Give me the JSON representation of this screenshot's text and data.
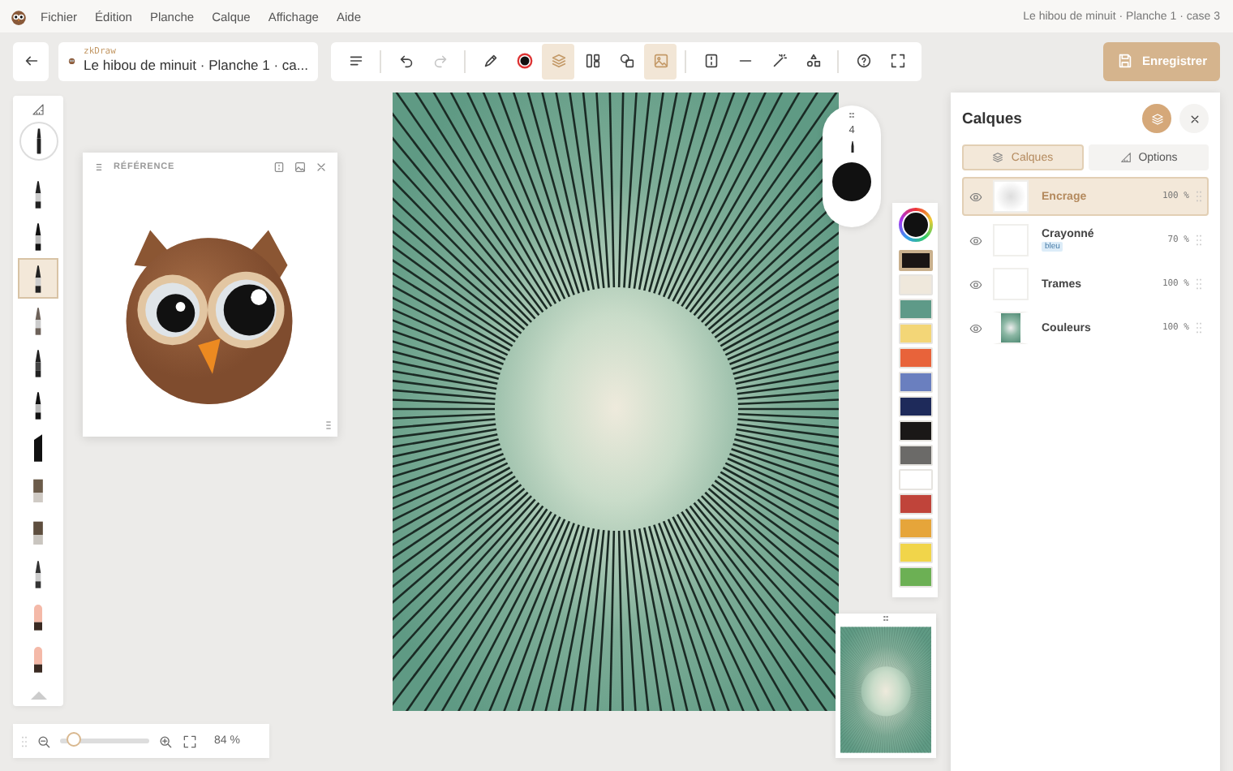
{
  "menu": [
    "Fichier",
    "Édition",
    "Planche",
    "Calque",
    "Affichage",
    "Aide"
  ],
  "document_title": "Le hibou de minuit · Planche 1 · case 3",
  "project": {
    "app": "zkDraw",
    "title": "Le hibou de minuit · Planche 1 · ca..."
  },
  "toolbar": {
    "groups": [
      [
        {
          "kind": "menu",
          "selected": false,
          "disabled": false
        }
      ],
      [
        {
          "kind": "undo",
          "selected": false,
          "disabled": false
        },
        {
          "kind": "redo",
          "selected": false,
          "disabled": true
        }
      ],
      [
        {
          "kind": "pen",
          "selected": false,
          "disabled": false
        },
        {
          "kind": "color",
          "selected": false,
          "disabled": false
        },
        {
          "kind": "layers",
          "selected": true,
          "disabled": false
        },
        {
          "kind": "panels",
          "selected": false,
          "disabled": false
        },
        {
          "kind": "shapes",
          "selected": false,
          "disabled": false
        },
        {
          "kind": "image",
          "selected": true,
          "disabled": false
        }
      ],
      [
        {
          "kind": "split",
          "selected": false,
          "disabled": false
        },
        {
          "kind": "line",
          "selected": false,
          "disabled": false
        },
        {
          "kind": "magic",
          "selected": false,
          "disabled": false
        },
        {
          "kind": "objects",
          "selected": false,
          "disabled": false
        }
      ],
      [
        {
          "kind": "help",
          "selected": false,
          "disabled": false
        },
        {
          "kind": "fullscreen",
          "selected": false,
          "disabled": false
        }
      ]
    ]
  },
  "save_button": "Enregistrer",
  "brushes": [
    {
      "kind": "pen",
      "selected": false
    },
    {
      "kind": "ink",
      "selected": false
    },
    {
      "kind": "pen",
      "selected": true
    },
    {
      "kind": "pencil",
      "selected": false
    },
    {
      "kind": "marker",
      "selected": false
    },
    {
      "kind": "ink",
      "selected": false
    },
    {
      "kind": "chisel",
      "selected": false
    },
    {
      "kind": "brush",
      "selected": false
    },
    {
      "kind": "flat",
      "selected": false
    },
    {
      "kind": "airbrush",
      "selected": false
    },
    {
      "kind": "eraser",
      "selected": false
    },
    {
      "kind": "soft-eraser",
      "selected": false
    }
  ],
  "reference": {
    "title": "RÉFÉRENCE"
  },
  "brush_size": {
    "value": "4"
  },
  "palette": [
    {
      "color": "#1a1514",
      "selected": true
    },
    {
      "color": "#efe8dc",
      "selected": false
    },
    {
      "color": "#5e9a88",
      "selected": false
    },
    {
      "color": "#f3d677",
      "selected": false
    },
    {
      "color": "#e8633a",
      "selected": false
    },
    {
      "color": "#6a7fbf",
      "selected": false
    },
    {
      "color": "#1e2a5a",
      "selected": false
    },
    {
      "color": "#1a1817",
      "selected": false
    },
    {
      "color": "#6b6a68",
      "selected": false
    },
    {
      "color": "#ffffff",
      "selected": false
    },
    {
      "color": "#c0443a",
      "selected": false
    },
    {
      "color": "#e6a53a",
      "selected": false
    },
    {
      "color": "#f1d54a",
      "selected": false
    },
    {
      "color": "#6cb054",
      "selected": false
    }
  ],
  "layers_panel": {
    "title": "Calques",
    "tabs": [
      {
        "label": "Calques",
        "selected": true
      },
      {
        "label": "Options",
        "selected": false
      }
    ],
    "layers": [
      {
        "name": "Encrage",
        "opacity": "100 %",
        "kind": "glow",
        "selected": true,
        "visible": true
      },
      {
        "name": "Crayonné",
        "tag": "bleu",
        "opacity": "70 %",
        "kind": "blank",
        "selected": false,
        "visible": true
      },
      {
        "name": "Trames",
        "opacity": "100 %",
        "kind": "blank",
        "selected": false,
        "visible": true
      },
      {
        "name": "Couleurs",
        "opacity": "100 %",
        "kind": "color",
        "selected": false,
        "visible": true
      }
    ]
  },
  "zoom": {
    "level": 0.15,
    "reading": "84 %"
  }
}
